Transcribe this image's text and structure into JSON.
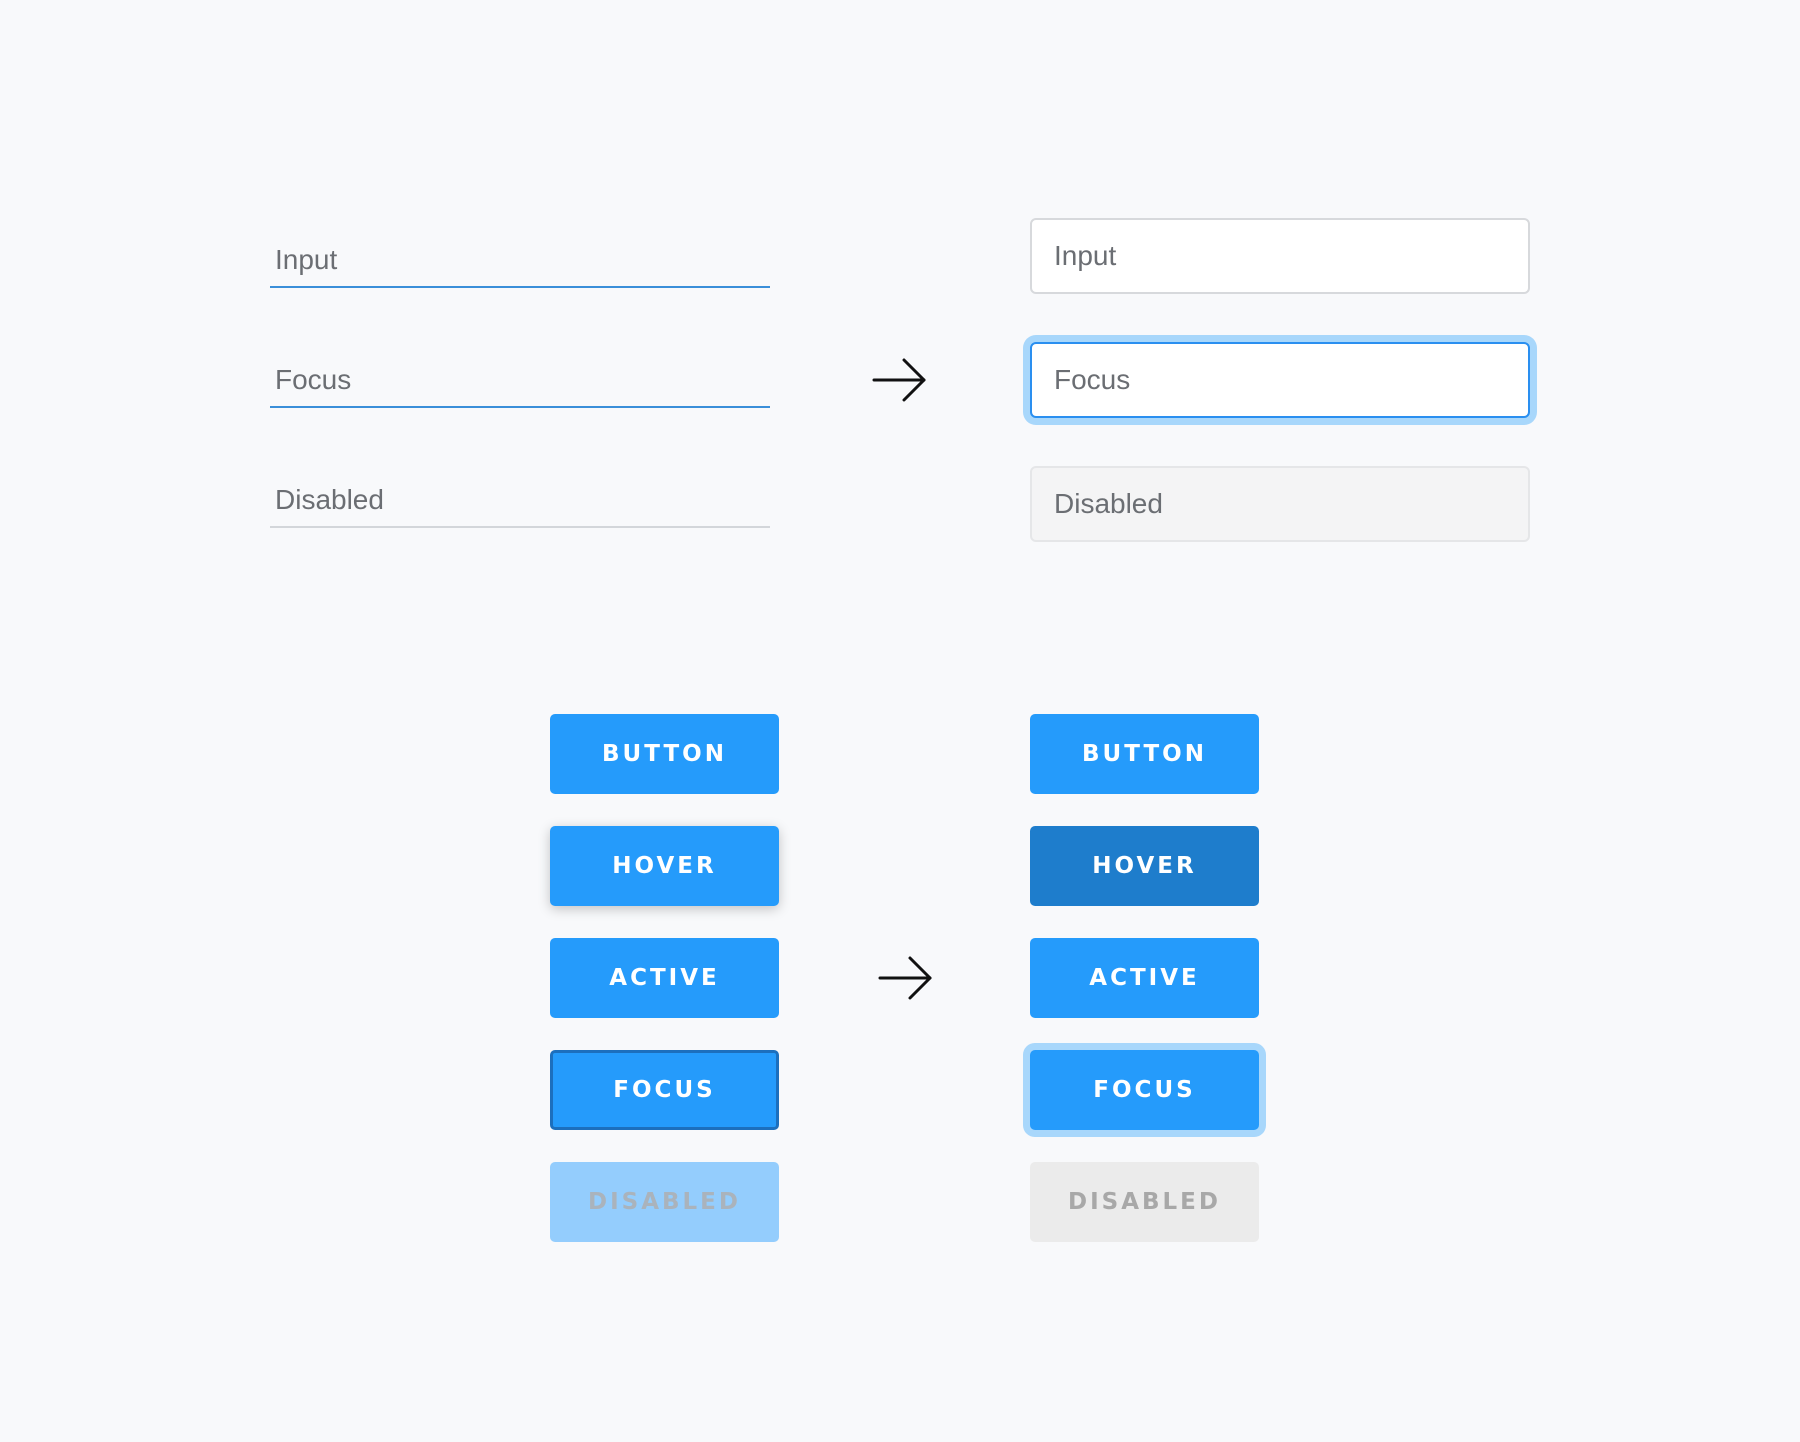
{
  "inputs_before": {
    "input_label": "Input",
    "focus_label": "Focus",
    "disabled_label": "Disabled"
  },
  "inputs_after": {
    "input_label": "Input",
    "focus_label": "Focus",
    "disabled_label": "Disabled"
  },
  "buttons_before": {
    "default_label": "BUTTON",
    "hover_label": "HOVER",
    "active_label": "ACTIVE",
    "focus_label": "FOCUS",
    "disabled_label": "DISABLED"
  },
  "buttons_after": {
    "default_label": "BUTTON",
    "hover_label": "HOVER",
    "active_label": "ACTIVE",
    "focus_label": "FOCUS",
    "disabled_label": "DISABLED"
  },
  "icons": {
    "inputs_arrow": "arrow-right-icon",
    "buttons_arrow": "arrow-right-icon"
  },
  "colors": {
    "background": "#f8f9fb",
    "primary": "#259bfb",
    "primary_hover": "#1e7dcc",
    "focus_ring": "#a8d7fb",
    "underline": "#3b8fd9",
    "disabled_old": "#94cdfd",
    "disabled_new": "#ebebeb"
  }
}
